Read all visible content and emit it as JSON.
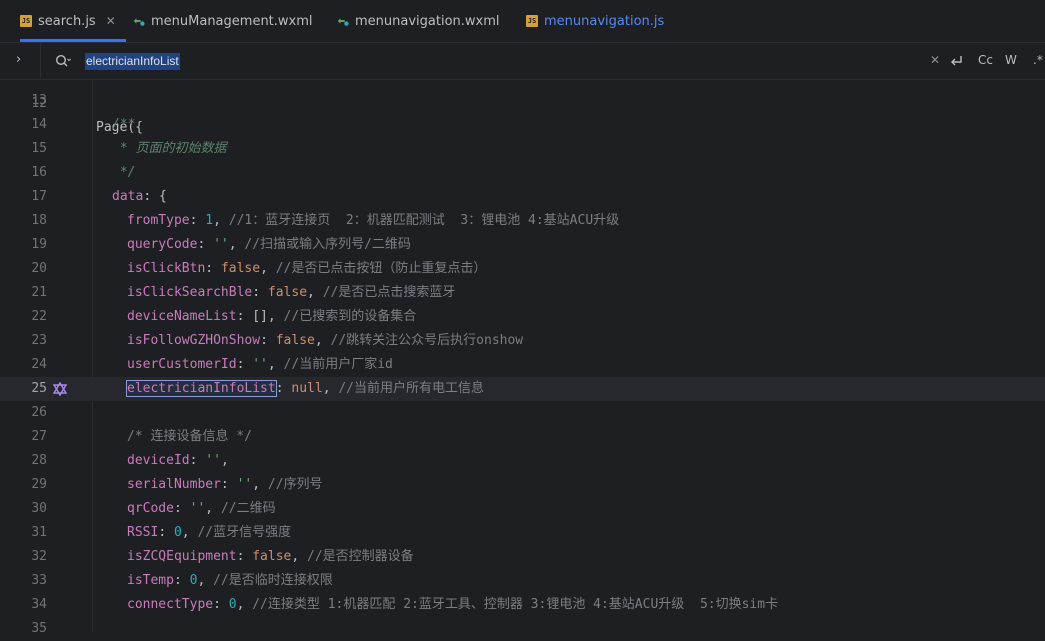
{
  "tabs": [
    {
      "label": "search.js",
      "icon": "js-file-icon",
      "active": true,
      "closable": true
    },
    {
      "label": "menuManagement.wxml",
      "icon": "wxml-file-icon",
      "active": false
    },
    {
      "label": "menunavigation.wxml",
      "icon": "wxml-file-icon",
      "active": false
    },
    {
      "label": "menunavigation.js",
      "icon": "js-file-icon",
      "active": false,
      "modified": true
    }
  ],
  "find": {
    "query": "electricianInfoList",
    "toggles": [
      "Cc",
      "W",
      ".*"
    ]
  },
  "editor": {
    "partial_top_line": {
      "ln": "12",
      "text": "Page({"
    },
    "lines": [
      {
        "ln": "13"
      },
      {
        "ln": "14",
        "a": "/**"
      },
      {
        "ln": "15",
        "a": " * 页面的初始数据"
      },
      {
        "ln": "16",
        "a": " */"
      },
      {
        "ln": "17",
        "a": "data",
        "b": ": {"
      },
      {
        "ln": "18",
        "a": "fromType",
        "b": ": ",
        "v": "1",
        "d": ", ",
        "e": "//1：蓝牙连接页  2：机器匹配测试  3：锂电池 4:基站ACU升级"
      },
      {
        "ln": "19",
        "a": "queryCode",
        "b": ": ",
        "v": "''",
        "d": ", ",
        "e": "//扫描或输入序列号/二维码"
      },
      {
        "ln": "20",
        "a": "isClickBtn",
        "b": ": ",
        "v": "false",
        "d": ", ",
        "e": "//是否已点击按钮（防止重复点击）"
      },
      {
        "ln": "21",
        "a": "isClickSearchBle",
        "b": ": ",
        "v": "false",
        "d": ", ",
        "e": "//是否已点击搜索蓝牙"
      },
      {
        "ln": "22",
        "a": "deviceNameList",
        "b": ": ",
        "v": "[]",
        "d": ", ",
        "e": "//已搜索到的设备集合"
      },
      {
        "ln": "23",
        "a": "isFollowGZHOnShow",
        "b": ": ",
        "v": "false",
        "d": ", ",
        "e": "//跳转关注公众号后执行onshow"
      },
      {
        "ln": "24",
        "a": "userCustomerId",
        "b": ": ",
        "v": "''",
        "d": ", ",
        "e": "//当前用户厂家id"
      },
      {
        "ln": "25",
        "a": "electricianInfoList",
        "b": ": ",
        "v": "null",
        "d": ", ",
        "e": "//当前用户所有电工信息"
      },
      {
        "ln": "26"
      },
      {
        "ln": "27",
        "a": "/* 连接设备信息 */"
      },
      {
        "ln": "28",
        "a": "deviceId",
        "b": ": ",
        "v": "''",
        "d": ","
      },
      {
        "ln": "29",
        "a": "serialNumber",
        "b": ": ",
        "v": "''",
        "d": ", ",
        "e": "//序列号"
      },
      {
        "ln": "30",
        "a": "qrCode",
        "b": ": ",
        "v": "''",
        "d": ", ",
        "e": "//二维码"
      },
      {
        "ln": "31",
        "a": "RSSI",
        "b": ": ",
        "v": "0",
        "d": ", ",
        "e": "//蓝牙信号强度"
      },
      {
        "ln": "32",
        "a": "isZCQEquipment",
        "b": ": ",
        "v": "false",
        "d": ", ",
        "e": "//是否控制器设备"
      },
      {
        "ln": "33",
        "a": "isTemp",
        "b": ": ",
        "v": "0",
        "d": ", ",
        "e": "//是否临时连接权限"
      },
      {
        "ln": "34",
        "a": "connectType",
        "b": ": ",
        "v": "0",
        "d": ", ",
        "e": "//连接类型 1:机器匹配 2:蓝牙工具、控制器 3:锂电池 4:基站ACU升级  5:切换sim卡"
      },
      {
        "ln": "35"
      }
    ]
  }
}
